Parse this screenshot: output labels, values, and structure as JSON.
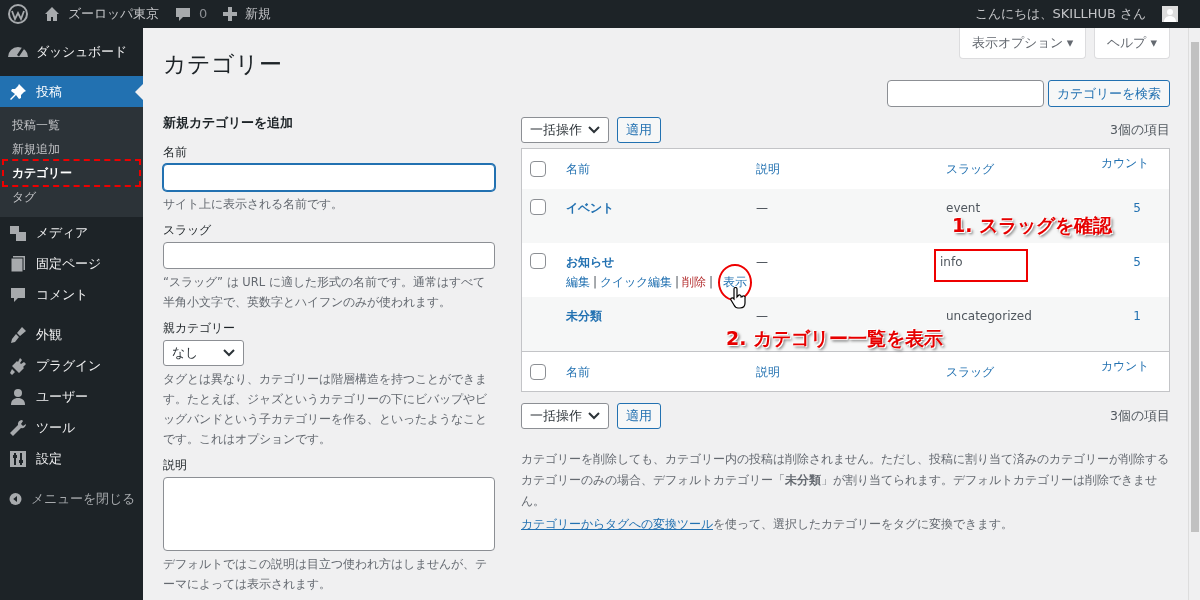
{
  "admin_bar": {
    "site_name": "ズーロッパ東京",
    "comments_count": "0",
    "new_label": "新規",
    "greeting": "こんにちは、SKILLHUB さん"
  },
  "sidebar": {
    "groups": [
      [
        {
          "label": "ダッシュボード",
          "selected": false
        }
      ],
      [
        {
          "label": "投稿",
          "selected": true,
          "children": [
            {
              "label": "投稿一覧",
              "selected": false,
              "highlighted": false
            },
            {
              "label": "新規追加",
              "selected": false,
              "highlighted": false
            },
            {
              "label": "カテゴリー",
              "selected": true,
              "highlighted": true
            },
            {
              "label": "タグ",
              "selected": false,
              "highlighted": false
            }
          ]
        },
        {
          "label": "メディア",
          "selected": false
        },
        {
          "label": "固定ページ",
          "selected": false
        },
        {
          "label": "コメント",
          "selected": false
        }
      ],
      [
        {
          "label": "外観",
          "selected": false
        },
        {
          "label": "プラグイン",
          "selected": false
        },
        {
          "label": "ユーザー",
          "selected": false
        },
        {
          "label": "ツール",
          "selected": false
        },
        {
          "label": "設定",
          "selected": false
        }
      ]
    ],
    "collapse_label": "メニューを閉じる"
  },
  "screen_tabs": [
    "表示オプション ▾",
    "ヘルプ ▾"
  ],
  "page_title": "カテゴリー",
  "search": {
    "button": "カテゴリーを検索"
  },
  "add_form": {
    "heading": "新規カテゴリーを追加",
    "fields": [
      {
        "kind": "text",
        "label": "名前",
        "focused": true,
        "help": "サイト上に表示される名前です。"
      },
      {
        "kind": "text",
        "label": "スラッグ",
        "focused": false,
        "help": "“スラッグ” は URL に適した形式の名前です。通常はすべて半角小文字で、英数字とハイフンのみが使われます。"
      },
      {
        "kind": "select",
        "label": "親カテゴリー",
        "value": "なし",
        "help": "タグとは異なり、カテゴリーは階層構造を持つことができます。たとえば、ジャズというカテゴリーの下にビバップやビッグバンドという子カテゴリーを作る、といったようなことです。これはオプションです。"
      },
      {
        "kind": "textarea",
        "label": "説明",
        "focused": false,
        "help": "デフォルトではこの説明は目立つ使われ方はしませんが、テーマによっては表示されます。"
      }
    ]
  },
  "top_nav": {
    "bulk_action": "一括操作",
    "apply": "適用",
    "count": "3個の項目"
  },
  "table": {
    "header_checked": false,
    "footer_checked": false,
    "columns": [
      "名前",
      "説明",
      "スラッグ",
      "カウント"
    ],
    "rows": [
      {
        "name": "イベント",
        "checked": false,
        "description": "—",
        "slug": "event",
        "slug_highlighted": false,
        "count": "5",
        "row_actions": []
      },
      {
        "name": "お知らせ",
        "checked": false,
        "description": "—",
        "slug": "info",
        "slug_highlighted": true,
        "count": "5",
        "row_actions": [
          {
            "label": "編集",
            "kind": "normal",
            "circled": false
          },
          {
            "separator": "|",
            "label": "クイック編集",
            "kind": "normal",
            "circled": false
          },
          {
            "separator": "|",
            "label": "削除",
            "kind": "danger",
            "circled": false
          },
          {
            "separator": "|",
            "label": "表示",
            "kind": "normal",
            "circled": true
          }
        ]
      },
      {
        "name": "未分類",
        "description": "—",
        "slug": "uncategorized",
        "slug_highlighted": false,
        "count": "1",
        "row_actions": []
      }
    ],
    "footer_columns": [
      "名前",
      "説明",
      "スラッグ",
      "カウント"
    ]
  },
  "bottom_nav": {
    "bulk_action": "一括操作",
    "apply": "適用",
    "count": "3個の項目"
  },
  "notes": {
    "text": "カテゴリーを削除しても、カテゴリー内の投稿は削除されません。ただし、投稿に割り当て済みのカテゴリーが削除するカテゴリーのみの場合、デフォルトカテゴリー「**未分類**」が割り当てられます。デフォルトカテゴリーは削除できません。",
    "link": "カテゴリーからタグへの変換ツール",
    "link_suffix": "を使って、選択したカテゴリーをタグに変換できます。"
  },
  "annotations": [
    {
      "text": "1. スラッグを確認"
    },
    {
      "text": "2. カテゴリー一覧を表示"
    }
  ]
}
